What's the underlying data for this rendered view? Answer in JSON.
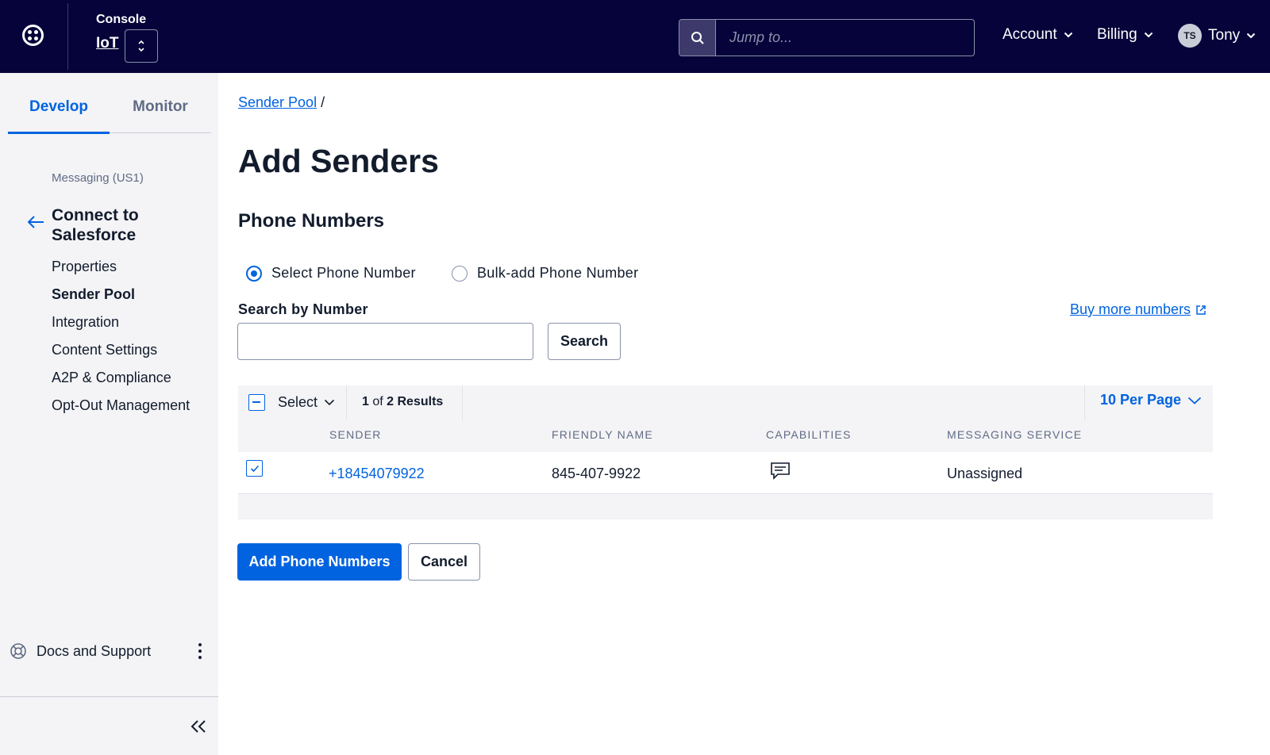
{
  "header": {
    "console_label": "Console",
    "product_name": "IoT",
    "search_placeholder": "Jump to...",
    "account_label": "Account",
    "billing_label": "Billing",
    "user_initials": "TS",
    "user_name": "Tony"
  },
  "sidebar": {
    "tabs": [
      {
        "label": "Develop",
        "active": true
      },
      {
        "label": "Monitor",
        "active": false
      }
    ],
    "section_label": "Messaging (US1)",
    "nav_title": "Connect to Salesforce",
    "items": [
      {
        "label": "Properties",
        "active": false
      },
      {
        "label": "Sender Pool",
        "active": true
      },
      {
        "label": "Integration",
        "active": false
      },
      {
        "label": "Content Settings",
        "active": false
      },
      {
        "label": "A2P & Compliance",
        "active": false
      },
      {
        "label": "Opt-Out Management",
        "active": false
      }
    ],
    "docs_label": "Docs and Support"
  },
  "main": {
    "breadcrumb_link": "Sender Pool",
    "breadcrumb_sep": "/",
    "title": "Add Senders",
    "section_title": "Phone Numbers",
    "radio_select": "Select Phone Number",
    "radio_bulk": "Bulk-add Phone Number",
    "search_label": "Search by Number",
    "search_value": "",
    "search_button": "Search",
    "buy_link": "Buy more numbers",
    "table": {
      "select_label": "Select",
      "results_current": "1",
      "results_of": "of",
      "results_total": "2 Results",
      "per_page": "10 Per Page",
      "columns": [
        "SENDER",
        "FRIENDLY NAME",
        "CAPABILITIES",
        "MESSAGING SERVICE"
      ],
      "rows": [
        {
          "checked": true,
          "sender": "+18454079922",
          "friendly_name": "845-407-9922",
          "capability_icon": "message-icon",
          "messaging_service": "Unassigned"
        }
      ]
    },
    "add_button": "Add Phone Numbers",
    "cancel_button": "Cancel"
  },
  "colors": {
    "topbar": "#06033a",
    "accent": "#0263e0",
    "sidebar_bg": "#f4f4f6",
    "text": "#121c2d",
    "muted": "#606b85"
  }
}
